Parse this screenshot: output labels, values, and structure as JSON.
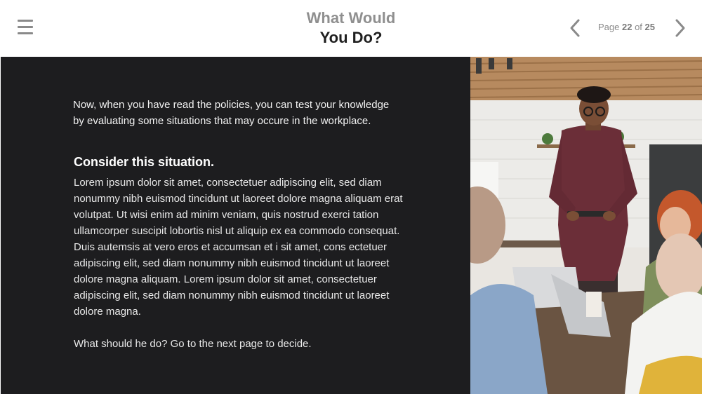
{
  "header": {
    "title_line1": "What Would",
    "title_line2": "You Do?",
    "menu_icon": "hamburger-menu-icon",
    "prev_icon": "chevron-left-icon",
    "next_icon": "chevron-right-icon",
    "pagination": {
      "prefix": "Page",
      "current": "22",
      "separator": "of",
      "total": "25"
    }
  },
  "content": {
    "intro": "Now, when you have read the policies, you can test your knowledge by evaluating some situations that may occure in the workplace.",
    "heading": "Consider this situation.",
    "body": "Lorem ipsum dolor sit amet, consectetuer adipiscing elit, sed diam nonummy nibh euismod tincidunt ut laoreet dolore magna aliquam erat volutpat. Ut wisi enim ad minim veniam, quis nostrud exerci tation ullamcorper suscipit lobortis nisl ut aliquip ex ea commodo consequat. Duis autemsis at vero eros et accumsan et i sit amet, cons ectetuer adipiscing elit, sed diam nonummy nibh euismod tincidunt ut laoreet dolore magna aliquam. Lorem ipsum dolor sit amet, consectetuer adipiscing elit, sed diam nonummy nibh euismod tincidunt ut laoreet dolore magna.",
    "question": "What should he do? Go to the next page to decide."
  },
  "colors": {
    "panel_background": "#1d1d1f",
    "title_gray": "#8f8f8f",
    "title_dark": "#1f1f1f",
    "icon_gray": "#8a8a8a"
  }
}
